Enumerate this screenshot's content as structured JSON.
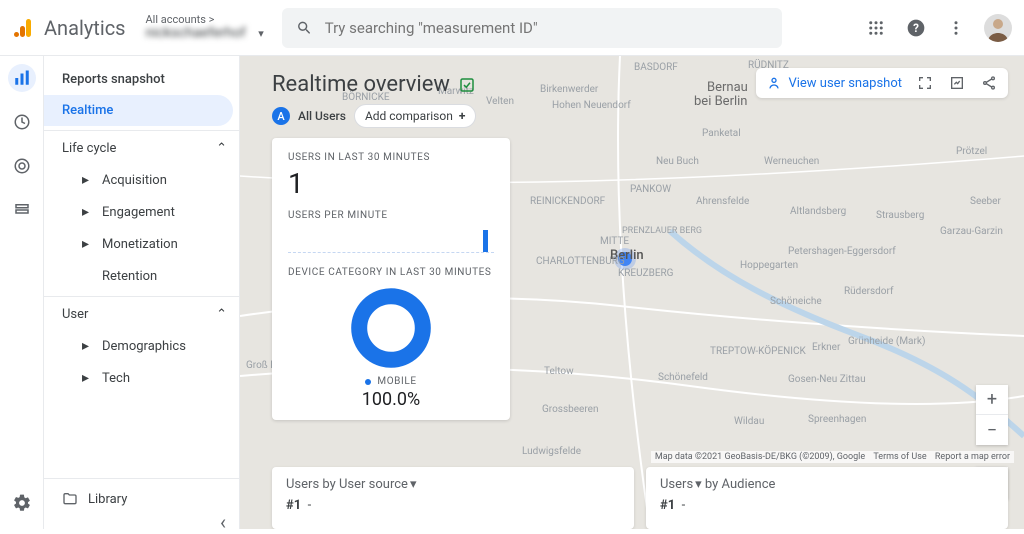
{
  "header": {
    "product": "Analytics",
    "account_top": "All accounts >",
    "account_bottom": "nickschaeferhof",
    "search_placeholder": "Try searching \"measurement ID\""
  },
  "rail": {
    "items": [
      "reports",
      "explore",
      "advertising",
      "configure"
    ]
  },
  "sidebar": {
    "snapshot": "Reports snapshot",
    "realtime": "Realtime",
    "lifecycle": {
      "label": "Life cycle",
      "items": [
        "Acquisition",
        "Engagement",
        "Monetization",
        "Retention"
      ]
    },
    "user": {
      "label": "User",
      "items": [
        "Demographics",
        "Tech"
      ]
    },
    "library": "Library"
  },
  "page": {
    "title": "Realtime overview",
    "chip_all_users": "All Users",
    "chip_add_comparison": "Add comparison",
    "view_snapshot": "View user snapshot"
  },
  "card": {
    "users_label": "USERS IN LAST 30 MINUTES",
    "users_value": "1",
    "upm_label": "USERS PER MINUTE",
    "device_label": "DEVICE CATEGORY IN LAST 30 MINUTES",
    "device_legend": "MOBILE",
    "device_pct": "100.0%"
  },
  "chart_data": {
    "type": "pie",
    "title": "Device category in last 30 minutes",
    "series": [
      {
        "name": "Mobile",
        "value": 100.0
      }
    ]
  },
  "bottom_cards": {
    "left_prefix": "Users by",
    "left_dim": "User source",
    "right_prefix": "Users",
    "right_by": "by",
    "right_dim": "Audience",
    "rank": "#1",
    "dash": "-"
  },
  "map": {
    "attrib1": "Map data ©2021 GeoBasis-DE/BKG (©2009), Google",
    "attrib2": "Terms of Use",
    "attrib3": "Report a map error",
    "focus": "Berlin",
    "sublabel1": "Bernau",
    "sublabel2": "bei Berlin",
    "labels": [
      "Marwitz",
      "Velten",
      "Birkenwerder",
      "Hohen Neuendorf",
      "BASDORF",
      "RÜDNITZ",
      "BÖRNICKE",
      "Panketal",
      "Neu Buch",
      "Werneuchen",
      "Prötzel",
      "PANKOW",
      "REINICKENDORF",
      "Ahrensfelde",
      "Altlandsberg",
      "Strausberg",
      "Seeber",
      "Garzau-Garzin",
      "MITTE",
      "PRENZLAUER BERG",
      "CHARLOTTENBURG",
      "KREUZBERG",
      "Petershagen-Eggersdorf",
      "Hoppegarten",
      "Schöneiche",
      "Rüdersdorf",
      "Groß Kreutz",
      "Teltow",
      "Schönefeld",
      "TREPTOW-KÖPENICK",
      "Erkner",
      "Grünheide (Mark)",
      "Grossbeeren",
      "Gosen-Neu Zittau",
      "Wildau",
      "Spreenhagen",
      "Ludwigsfelde"
    ]
  }
}
